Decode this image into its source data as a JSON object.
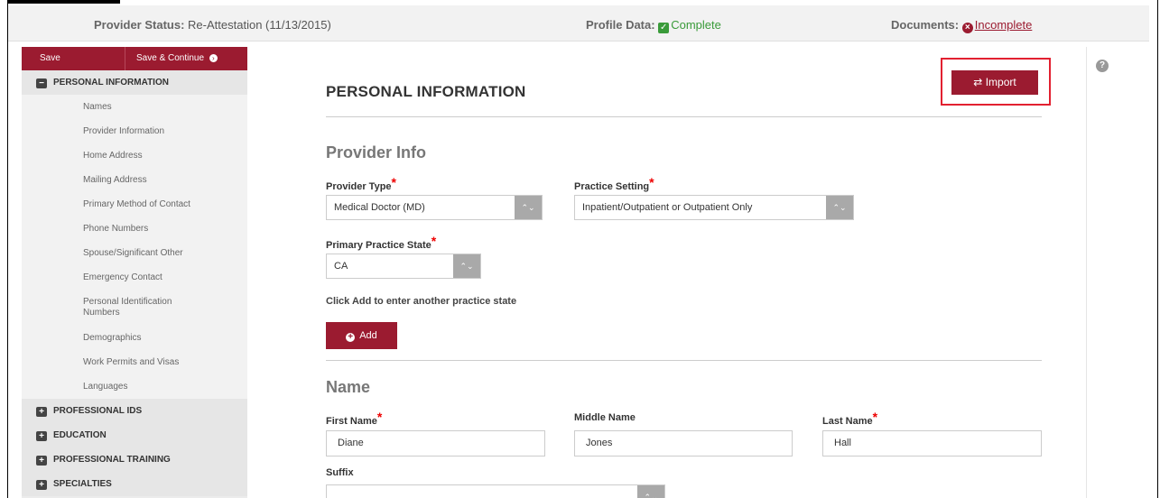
{
  "status": {
    "provider_status_label": "Provider Status:",
    "provider_status_value": "Re-Attestation (11/13/2015)",
    "profile_data_label": "Profile Data:",
    "profile_data_value": "Complete",
    "documents_label": "Documents:",
    "documents_value": "Incomplete"
  },
  "sidebar": {
    "save_label": "Save",
    "save_continue_label": "Save & Continue",
    "sections": [
      {
        "label": "PERSONAL INFORMATION",
        "expanded": true
      },
      {
        "label": "PROFESSIONAL IDS",
        "expanded": false
      },
      {
        "label": "EDUCATION",
        "expanded": false
      },
      {
        "label": "PROFESSIONAL TRAINING",
        "expanded": false
      },
      {
        "label": "SPECIALTIES",
        "expanded": false
      }
    ],
    "items": [
      "Names",
      "Provider Information",
      "Home Address",
      "Mailing Address",
      "Primary Method of Contact",
      "Phone Numbers",
      "Spouse/Significant Other",
      "Emergency Contact",
      "Personal Identification Numbers",
      "Demographics",
      "Work Permits and Visas",
      "Languages"
    ]
  },
  "main": {
    "page_title": "PERSONAL INFORMATION",
    "import_label": "Import",
    "provider_info": {
      "heading": "Provider Info",
      "provider_type_label": "Provider Type",
      "provider_type_value": "Medical Doctor (MD)",
      "practice_setting_label": "Practice Setting",
      "practice_setting_value": "Inpatient/Outpatient or Outpatient Only",
      "primary_state_label": "Primary Practice State",
      "primary_state_value": "CA",
      "hint": "Click Add to enter another practice state",
      "add_label": "Add"
    },
    "name": {
      "heading": "Name",
      "first_name_label": "First Name",
      "first_name_value": "Diane",
      "middle_name_label": "Middle Name",
      "middle_name_value": "Jones",
      "last_name_label": "Last Name",
      "last_name_value": "Hall",
      "suffix_label": "Suffix",
      "suffix_value": ""
    }
  },
  "colors": {
    "accent": "#9b1b30",
    "success": "#3a9b3a",
    "highlight_border": "#e22030"
  }
}
